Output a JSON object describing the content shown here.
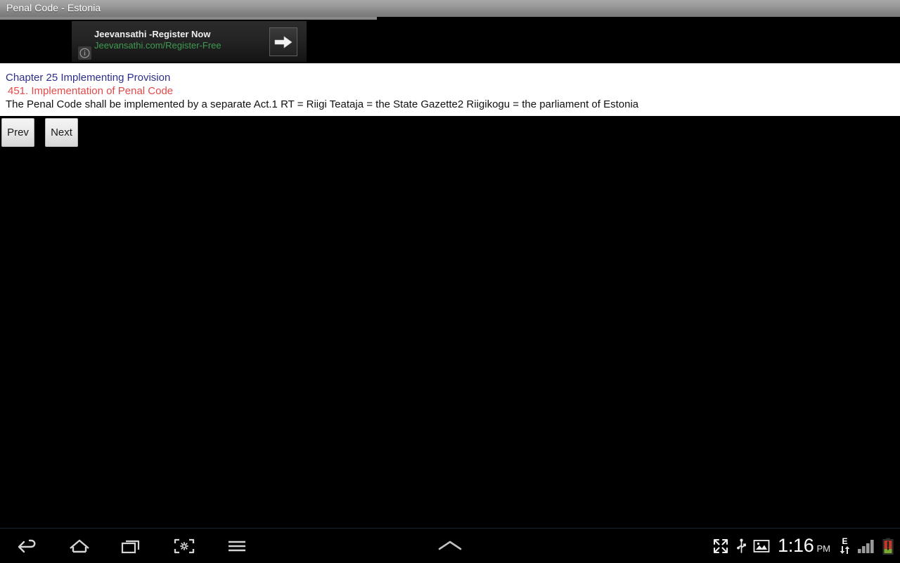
{
  "app": {
    "title": "Penal Code - Estonia"
  },
  "ad": {
    "headline": "Jeevansathi -Register Now",
    "url": "Jeevansathi.com/Register-Free",
    "info_icon": "info-icon",
    "cta_icon": "arrow-right-icon"
  },
  "content": {
    "chapter": "Chapter 25 Implementing Provision",
    "section": "451. Implementation of Penal Code",
    "body": "The Penal Code shall be implemented by a separate Act.1 RT = Riigi Teataja = the State Gazette2 Riigikogu = the parliament of Estonia"
  },
  "pager": {
    "prev_label": "Prev",
    "next_label": "Next"
  },
  "system_bar": {
    "nav_icons": [
      {
        "name": "back-icon",
        "label": "Back"
      },
      {
        "name": "home-icon",
        "label": "Home"
      },
      {
        "name": "recents-icon",
        "label": "Recent apps"
      },
      {
        "name": "screenshot-capture-icon",
        "label": "Screenshot"
      },
      {
        "name": "menu-icon",
        "label": "Menu"
      }
    ],
    "handle_icon": {
      "name": "chevron-up-icon",
      "label": "Notifications handle"
    },
    "status_icons": [
      {
        "name": "fullscreen-expand-icon",
        "label": "Fullscreen"
      },
      {
        "name": "usb-icon",
        "label": "USB connected"
      },
      {
        "name": "screenshot-saved-icon",
        "label": "Screenshot captured"
      }
    ],
    "clock": {
      "time": "1:16",
      "meridiem": "PM"
    },
    "network": {
      "type": "E",
      "data_arrows_icon": "data-transfer-icon",
      "signal_icon": "signal-bars-icon",
      "signal_bars": 4
    },
    "battery": {
      "icon": "battery-low-icon",
      "level_percent": 15
    }
  },
  "colors": {
    "title_bar": "#8a8a8a",
    "chapter_heading": "#2d2d8c",
    "section_heading": "#e24a4a",
    "ad_url": "#3f9b52",
    "page_background": "#000000",
    "content_background": "#ffffff"
  }
}
